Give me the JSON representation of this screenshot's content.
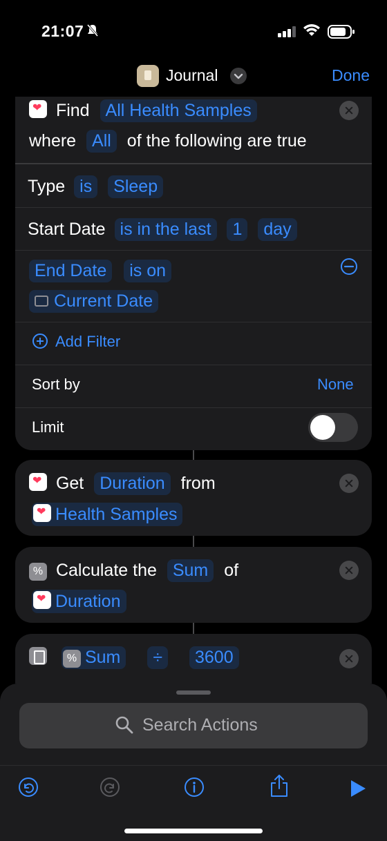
{
  "status_bar": {
    "time": "21:07"
  },
  "nav": {
    "app_name": "Journal",
    "done_label": "Done"
  },
  "find_card": {
    "find_label": "Find",
    "source": "All Health Samples",
    "where_label": "where",
    "quantifier": "All",
    "following_label": "of the following are true",
    "filters": [
      {
        "field": "Type",
        "operator": "is",
        "value": "Sleep"
      },
      {
        "field": "Start Date",
        "operator": "is in the last",
        "value": "1",
        "unit": "day"
      },
      {
        "field": "End Date",
        "operator": "is on",
        "value": "Current Date"
      }
    ],
    "add_filter_label": "Add Filter",
    "sort_label": "Sort by",
    "sort_value": "None",
    "limit_label": "Limit",
    "limit_enabled": false
  },
  "get_card": {
    "get_label": "Get",
    "property": "Duration",
    "from_label": "from",
    "input": "Health Samples"
  },
  "calc_card": {
    "label": "Calculate the",
    "operation": "Sum",
    "of_label": "of",
    "input": "Duration"
  },
  "math_card": {
    "input": "Sum",
    "operator": "÷",
    "operand": "3600"
  },
  "sheet": {
    "search_placeholder": "Search Actions"
  },
  "colors": {
    "accent": "#3a8cff",
    "card": "#1c1c1e",
    "background": "#000000",
    "health": "#ff3a5c"
  }
}
